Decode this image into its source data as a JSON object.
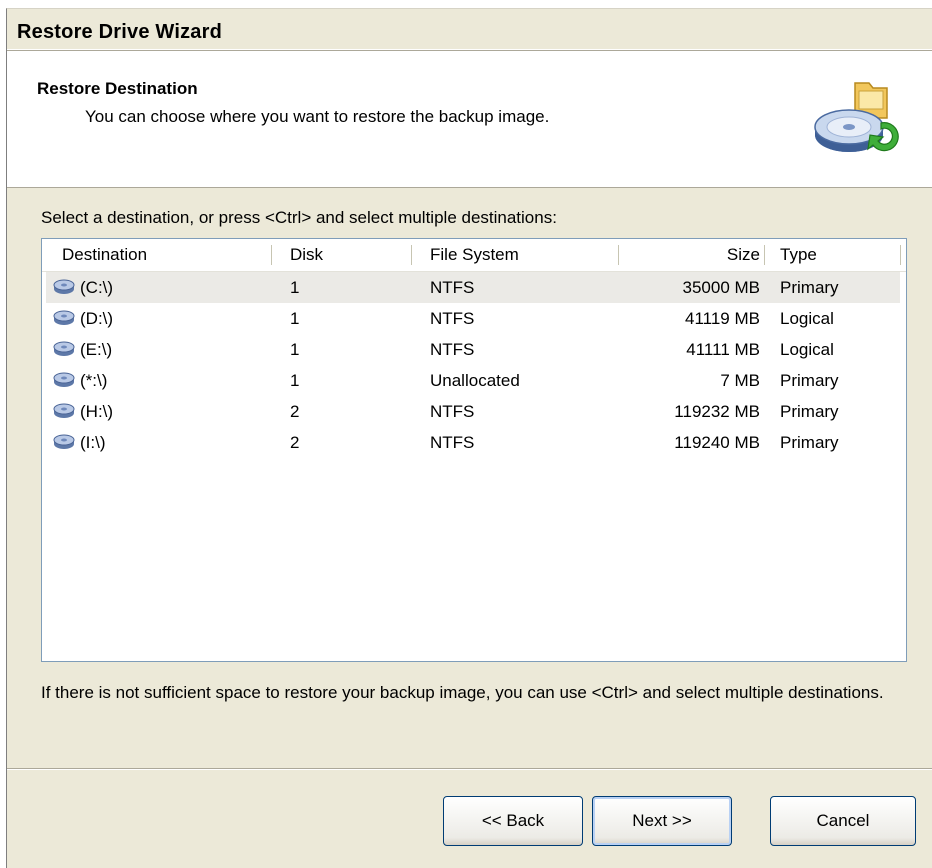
{
  "window": {
    "title": "Restore Drive Wizard"
  },
  "header": {
    "title": "Restore Destination",
    "subtitle": "You can choose where you want to restore the backup image.",
    "icon": "drive-restore-icon"
  },
  "prompt": "Select a destination, or press <Ctrl> and select multiple destinations:",
  "table": {
    "columns": [
      "Destination",
      "Disk",
      "File System",
      "Size",
      "Type"
    ],
    "rows": [
      {
        "destination": "(C:\\)",
        "disk": "1",
        "file_system": "NTFS",
        "size": "35000 MB",
        "type": "Primary",
        "icon": "drive-icon"
      },
      {
        "destination": "(D:\\)",
        "disk": "1",
        "file_system": "NTFS",
        "size": "41119 MB",
        "type": "Logical",
        "icon": "drive-icon"
      },
      {
        "destination": "(E:\\)",
        "disk": "1",
        "file_system": "NTFS",
        "size": "41111 MB",
        "type": "Logical",
        "icon": "drive-icon"
      },
      {
        "destination": "(*:\\)",
        "disk": "1",
        "file_system": "Unallocated",
        "size": "7 MB",
        "type": "Primary",
        "icon": "drive-icon"
      },
      {
        "destination": "(H:\\)",
        "disk": "2",
        "file_system": "NTFS",
        "size": "119232 MB",
        "type": "Primary",
        "icon": "drive-icon"
      },
      {
        "destination": "(I:\\)",
        "disk": "2",
        "file_system": "NTFS",
        "size": "119240 MB",
        "type": "Primary",
        "icon": "drive-icon"
      }
    ],
    "selected_row": 0
  },
  "footer_note": "If there is not sufficient space to restore your backup image, you can use <Ctrl> and select multiple destinations.",
  "buttons": {
    "back": "<< Back",
    "next": "Next >>",
    "cancel": "Cancel"
  },
  "colors": {
    "dialog_bg": "#ece9d8",
    "list_border": "#7f9db9",
    "button_border": "#003c74",
    "selected_row": "#ebeae6"
  }
}
